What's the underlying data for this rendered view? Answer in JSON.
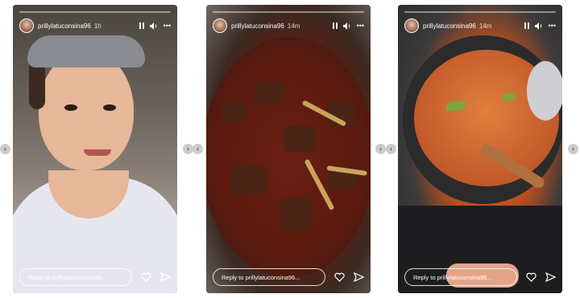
{
  "stories": [
    {
      "username": "prillylatuconsina96",
      "time": "1h",
      "reply_placeholder": "Reply to prillylatuconsina96..."
    },
    {
      "username": "prillylatuconsina96",
      "time": "14m",
      "reply_placeholder": "Reply to prillylatuconsina96..."
    },
    {
      "username": "prillylatuconsina96",
      "time": "14m",
      "reply_placeholder": "Reply to prillylatuconsina96..."
    }
  ],
  "icons": {
    "pause": "pause-icon",
    "sound": "speaker-icon",
    "more": "more-icon",
    "like": "heart-icon",
    "share": "send-icon",
    "prev": "chevron-left-icon",
    "next": "chevron-right-icon"
  }
}
